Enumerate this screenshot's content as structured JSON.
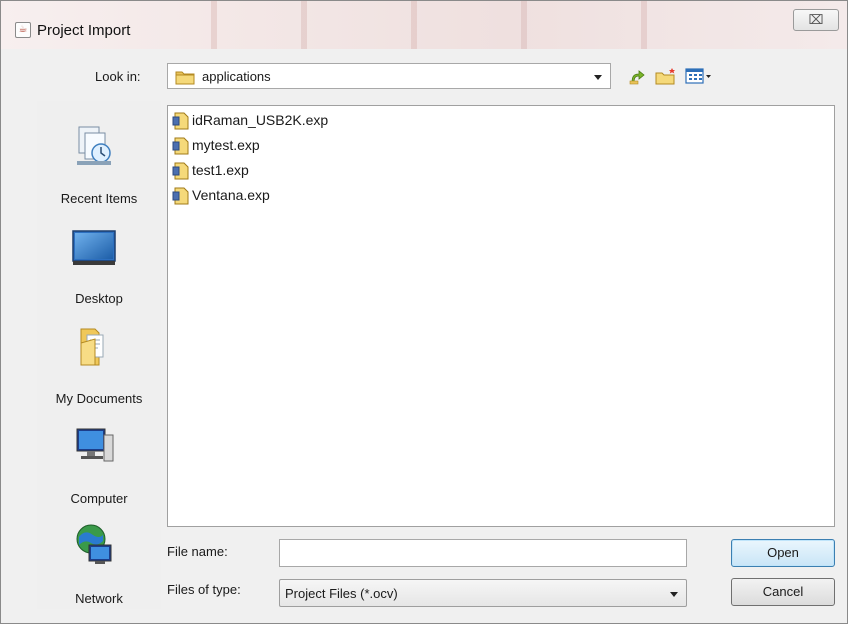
{
  "window": {
    "title": "Project Import",
    "close_glyph": "⌧",
    "accent_color": "#3c7fb1"
  },
  "look_in": {
    "label": "Look in:",
    "value": "applications",
    "icon": "folder-icon"
  },
  "toolbar": {
    "icons": [
      "up-one-level-icon",
      "create-new-folder-icon",
      "view-menu-icon"
    ]
  },
  "places": [
    {
      "label": "Recent Items",
      "icon": "recent-items-icon"
    },
    {
      "label": "Desktop",
      "icon": "desktop-icon"
    },
    {
      "label": "My Documents",
      "icon": "documents-folder-icon"
    },
    {
      "label": "Computer",
      "icon": "computer-icon"
    },
    {
      "label": "Network",
      "icon": "network-globe-icon"
    }
  ],
  "files": [
    {
      "name": "idRaman_USB2K.exp",
      "icon": "project-file-icon"
    },
    {
      "name": "mytest.exp",
      "icon": "project-file-icon"
    },
    {
      "name": "test1.exp",
      "icon": "project-file-icon"
    },
    {
      "name": "Ventana.exp",
      "icon": "project-file-icon"
    }
  ],
  "file_name": {
    "label": "File name:",
    "value": "",
    "placeholder": ""
  },
  "file_type": {
    "label": "Files of type:",
    "value": "Project Files (*.ocv)"
  },
  "buttons": {
    "open": "Open",
    "cancel": "Cancel"
  }
}
